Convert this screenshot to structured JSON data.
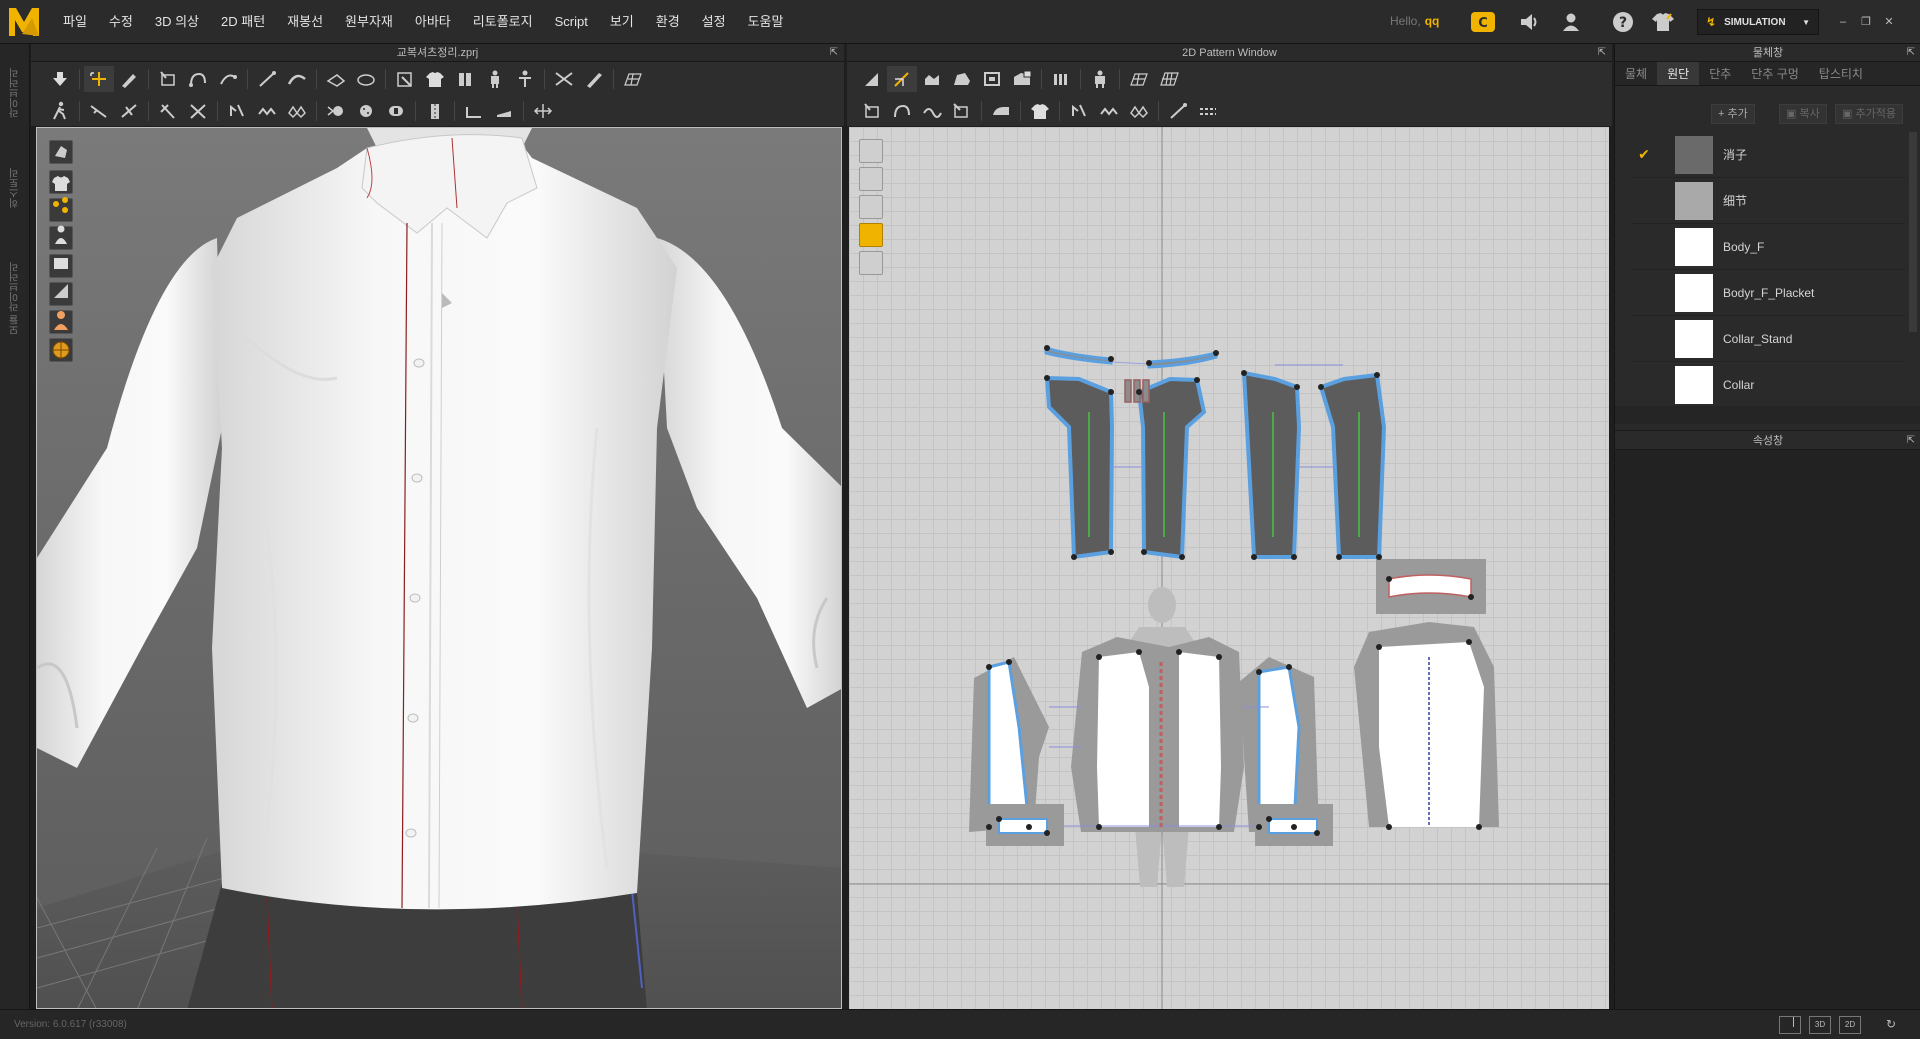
{
  "app": {
    "logo_alt": "MD",
    "menu": [
      "파일",
      "수정",
      "3D 의상",
      "2D 패턴",
      "재봉선",
      "원부자재",
      "아바타",
      "리토폴로지",
      "Script",
      "보기",
      "환경",
      "설정",
      "도움말"
    ],
    "hello_label": "Hello,",
    "user": "qq",
    "mode": "SIMULATION",
    "accent": "#f0b400"
  },
  "left_strip": {
    "tabs": [
      "라이브러리",
      "히스토리",
      "모듈 라이브러리"
    ]
  },
  "view3d": {
    "title": "교복셔츠정리.zprj"
  },
  "view2d": {
    "title": "2D Pattern Window"
  },
  "object_browser": {
    "title": "물체창",
    "tabs": [
      "물체",
      "원단",
      "단추",
      "단추 구멍",
      "탑스티치"
    ],
    "active_tab": "원단",
    "buttons": {
      "add": "추가",
      "copy": "복사",
      "assign": "추가적용"
    },
    "fabrics": [
      {
        "name": "消子",
        "color": "#6a6a6a",
        "selected": true
      },
      {
        "name": "细节",
        "color": "#a9a9a9",
        "selected": false
      },
      {
        "name": "Body_F",
        "color": "#ffffff",
        "selected": false
      },
      {
        "name": "Bodyr_F_Placket",
        "color": "#ffffff",
        "selected": false
      },
      {
        "name": "Collar_Stand",
        "color": "#ffffff",
        "selected": false
      },
      {
        "name": "Collar",
        "color": "#ffffff",
        "selected": false
      }
    ]
  },
  "property_editor": {
    "title": "속성창"
  },
  "status": {
    "version": "Version: 6.0.617 (r33008)",
    "view_buttons": [
      "",
      "3D",
      "2D",
      ""
    ]
  }
}
